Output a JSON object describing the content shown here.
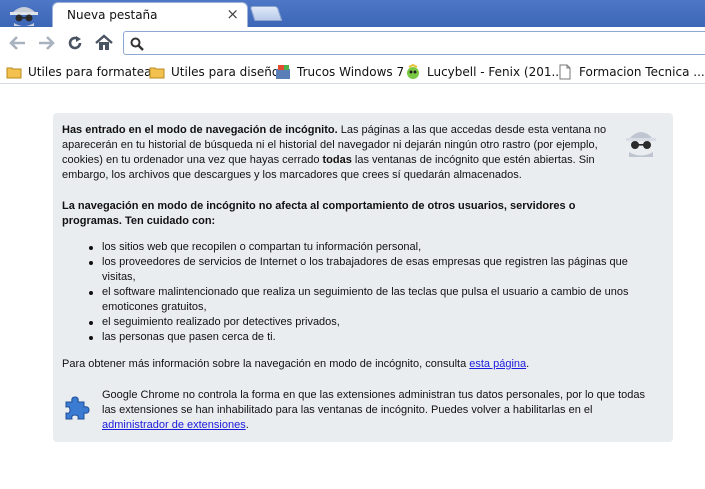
{
  "window": {
    "tab_title": "Nueva pestaña",
    "tab_close": "×"
  },
  "toolbar": {
    "back_icon": "back-arrow-icon",
    "forward_icon": "forward-arrow-icon",
    "reload_icon": "reload-icon",
    "home_icon": "home-icon",
    "omnibox_value": ""
  },
  "bookmarks": [
    {
      "label": "Utiles para formatear",
      "icon": "folder-icon"
    },
    {
      "label": "Utiles para diseño",
      "icon": "folder-icon"
    },
    {
      "label": "Trucos Windows 7",
      "icon": "windows-icon"
    },
    {
      "label": "Lucybell - Fenix (201...",
      "icon": "character-icon"
    },
    {
      "label": "Formacion Tecnica ...",
      "icon": "page-icon"
    }
  ],
  "incognito": {
    "p1_bold": "Has entrado en el modo de navegación de incógnito.",
    "p1_a": " Las páginas a las que accedas desde esta ventana no aparecerán en tu historial de búsqueda ni el historial del navegador ni dejarán ningún otro rastro (por ejemplo, cookies) en tu ordenador una vez que hayas cerrado ",
    "p1_bold2": "todas",
    "p1_b": " las ventanas de incógnito que estén abiertas. Sin embargo, los archivos que descargues y los marcadores que crees sí quedarán almacenados.",
    "p2": "La navegación en modo de incógnito no afecta al comportamiento de otros usuarios, servidores o programas. Ten cuidado con:",
    "bullets": [
      "los sitios web que recopilen o compartan tu información personal,",
      "los proveedores de servicios de Internet o los trabajadores de esas empresas que registren las páginas que visitas,",
      "el software malintencionado que realiza un seguimiento de las teclas que pulsa el usuario a cambio de unos emoticones gratuitos,",
      "el seguimiento realizado por detectives privados,",
      "las personas que pasen cerca de ti."
    ],
    "p3_text": "Para obtener más información sobre la navegación en modo de incógnito, consulta ",
    "p3_link": "esta página",
    "p3_end": ".",
    "ext_text": "Google Chrome no controla la forma en que las extensiones administran tus datos personales, por lo que todas las extensiones se han inhabilitado para las ventanas de incógnito. Puedes volver a habilitarlas en el ",
    "ext_link": "administrador de extensiones",
    "ext_end": "."
  },
  "colors": {
    "tabstrip": "#3f69b9",
    "infobox_bg": "#eaedf0",
    "link": "#1a1adb"
  }
}
